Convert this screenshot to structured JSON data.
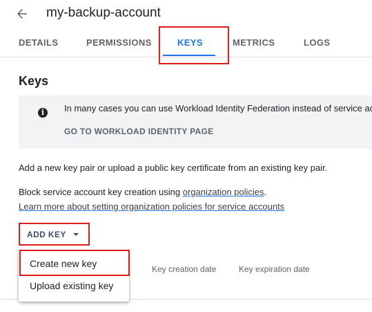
{
  "header": {
    "title": "my-backup-account",
    "back_icon": "arrow-back-icon"
  },
  "tabs": [
    {
      "label": "DETAILS"
    },
    {
      "label": "PERMISSIONS"
    },
    {
      "label": "KEYS",
      "active": true
    },
    {
      "label": "METRICS"
    },
    {
      "label": "LOGS"
    }
  ],
  "section": {
    "title": "Keys"
  },
  "banner": {
    "icon": "info-icon",
    "text": "In many cases you can use Workload Identity Federation instead of service ac",
    "link": "GO TO WORKLOAD IDENTITY PAGE"
  },
  "description": {
    "line1": "Add a new key pair or upload a public key certificate from an existing key pair.",
    "block_prefix": "Block service account key creation using ",
    "block_link": "organization policies",
    "block_suffix": ".",
    "learn_more": "Learn more about setting organization policies for service accounts"
  },
  "add_key": {
    "label": "ADD KEY",
    "icon": "caret-down-icon"
  },
  "table": {
    "columns": [
      "Key creation date",
      "Key expiration date"
    ]
  },
  "menu": {
    "items": [
      {
        "label": "Create new key"
      },
      {
        "label": "Upload existing key"
      }
    ]
  },
  "colors": {
    "accent": "#1a73e8",
    "highlight_box": "#e01b1b",
    "banner_bg": "#f1f3f4"
  }
}
